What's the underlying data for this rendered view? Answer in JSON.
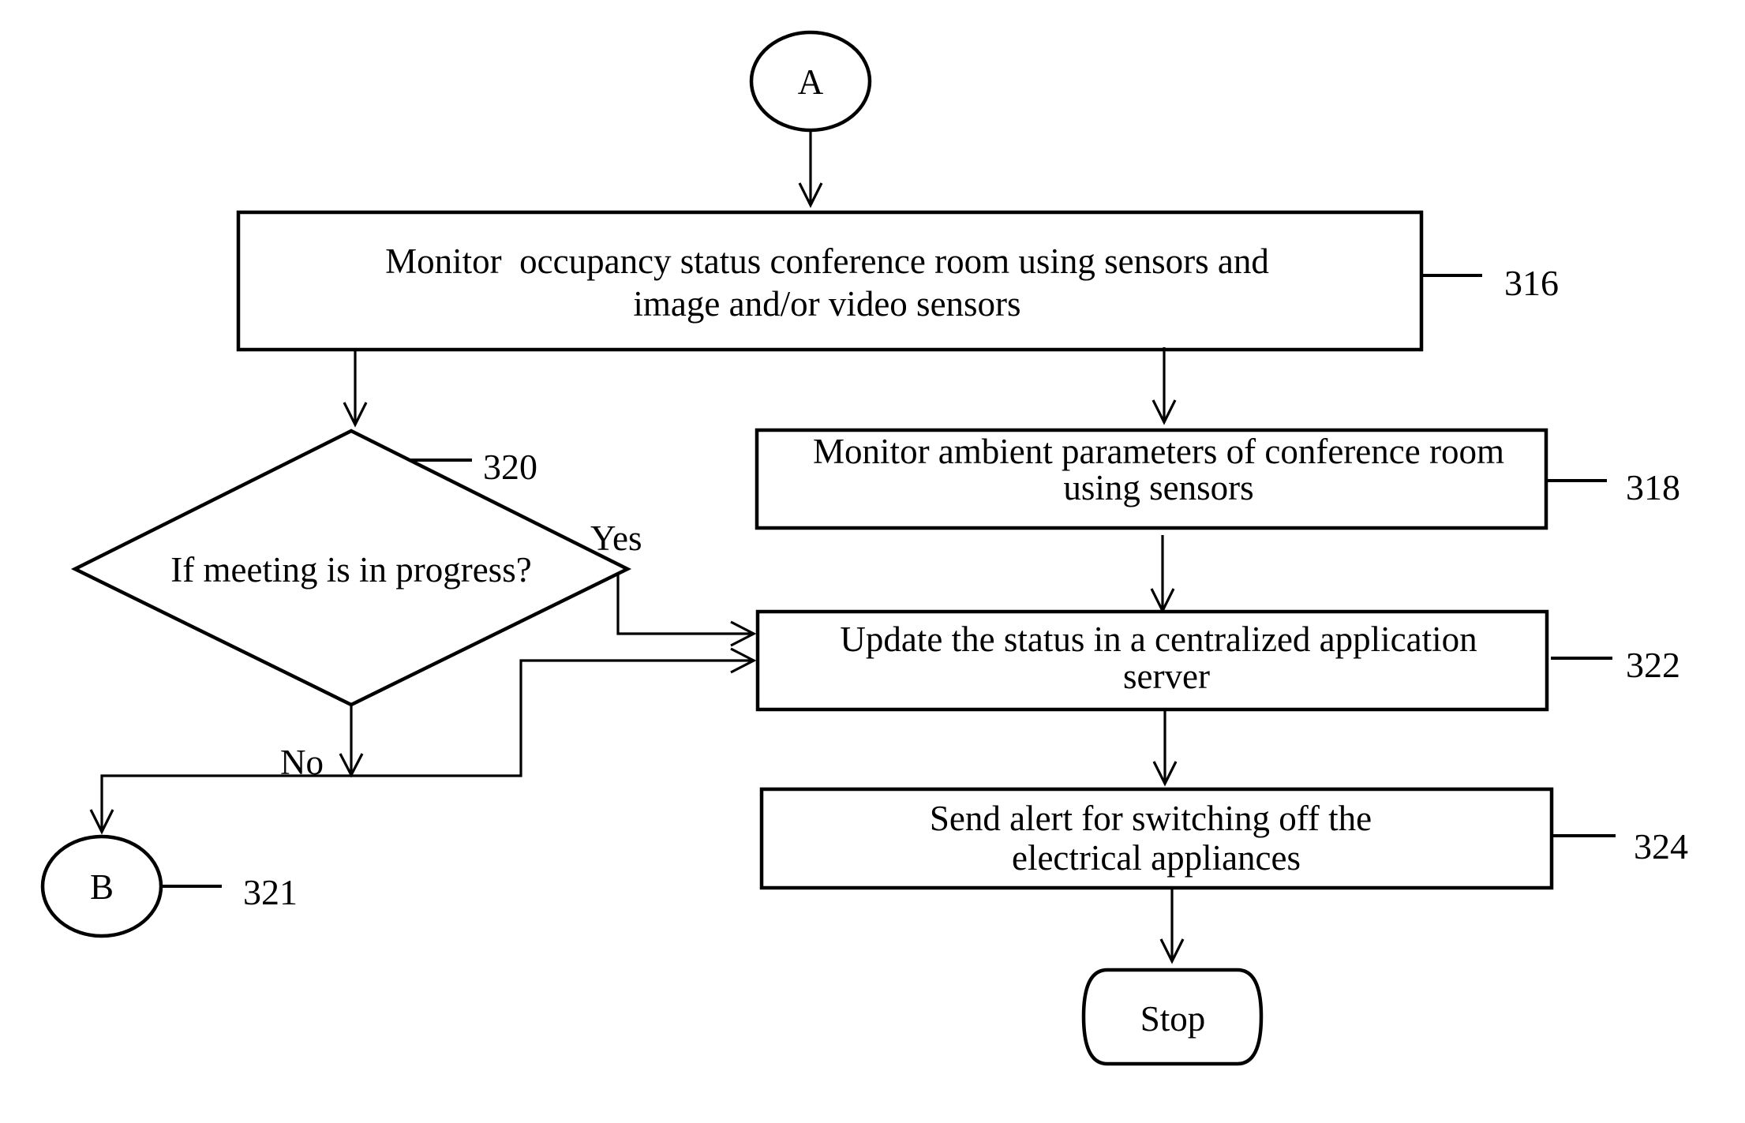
{
  "diagram": {
    "type": "flowchart",
    "connectors": {
      "start": {
        "label": "A"
      },
      "offpage": {
        "label": "B",
        "ref": "321"
      }
    },
    "steps": {
      "monitor_occupancy": {
        "ref": "316",
        "lines": [
          "Monitor  occupancy status conference room using sensors and",
          "image and/or video sensors"
        ]
      },
      "monitor_ambient": {
        "ref": "318",
        "lines": [
          "Monitor ambient parameters of conference room",
          "using sensors"
        ]
      },
      "meeting_decision": {
        "ref": "320",
        "lines": [
          "If meeting is in progress?"
        ],
        "yes_label": "Yes",
        "no_label": "No"
      },
      "update_status": {
        "ref": "322",
        "lines": [
          "Update the status in a centralized application",
          "server"
        ]
      },
      "send_alert": {
        "ref": "324",
        "lines": [
          "Send alert for switching off the",
          "electrical appliances"
        ]
      }
    },
    "terminal": {
      "label": "Stop"
    },
    "edges": [
      {
        "from": "A",
        "to": "316"
      },
      {
        "from": "316",
        "to": "320"
      },
      {
        "from": "316",
        "to": "318"
      },
      {
        "from": "318",
        "to": "322"
      },
      {
        "from": "320",
        "to": "322",
        "label": "Yes"
      },
      {
        "from": "320",
        "to": "B",
        "label": "No"
      },
      {
        "from": "320",
        "to": "322",
        "label": "No"
      },
      {
        "from": "322",
        "to": "324"
      },
      {
        "from": "324",
        "to": "Stop"
      }
    ]
  }
}
